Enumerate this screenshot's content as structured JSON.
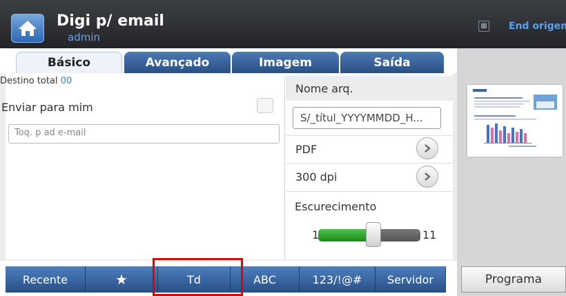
{
  "header": {
    "title": "Digi p/ email",
    "user": "admin",
    "end_label": "End origem"
  },
  "tabs": [
    {
      "label": "Básico",
      "active": true
    },
    {
      "label": "Avançado",
      "active": false
    },
    {
      "label": "Imagem",
      "active": false
    },
    {
      "label": "Saída",
      "active": false
    }
  ],
  "left": {
    "destino_label": "Destino total",
    "destino_count": "00",
    "send_to_me": "Enviar para mim",
    "send_to_me_checked": false,
    "email_placeholder": "Toq. p ad e-mail"
  },
  "right": {
    "filename_header": "Nome arq.",
    "filename_value": "S/_títul_YYYYMMDD_H...",
    "format": "PDF",
    "resolution": "300 dpi",
    "darkness_label": "Escurecimento",
    "darkness_min": "1",
    "darkness_max": "11",
    "darkness_level": 6
  },
  "bottom": {
    "buttons": [
      "Recente",
      "★",
      "Td",
      "ABC",
      "123/!@#",
      "Servidor"
    ],
    "program": "Programa"
  },
  "colors": {
    "accent": "#2e5b95",
    "highlight": "#e30000",
    "slider": "#2aa52a"
  }
}
